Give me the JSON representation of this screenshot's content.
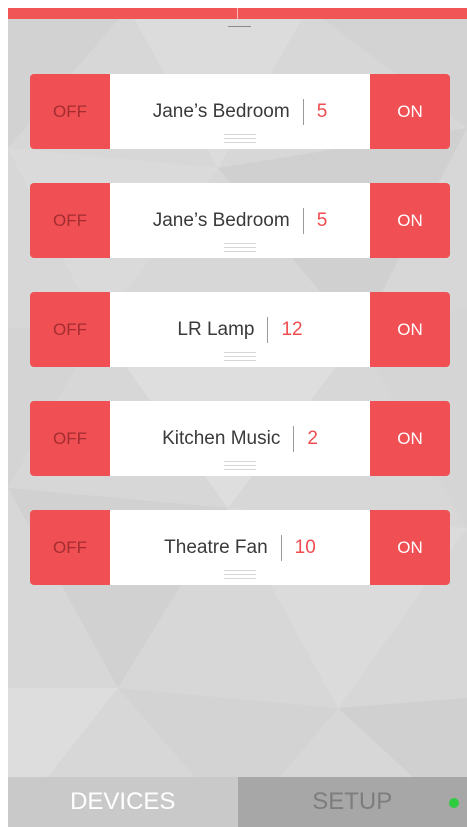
{
  "devices": [
    {
      "name": "Jane’s Bedroom",
      "count": "5",
      "off_label": "OFF",
      "on_label": "ON"
    },
    {
      "name": "Jane’s Bedroom",
      "count": "5",
      "off_label": "OFF",
      "on_label": "ON"
    },
    {
      "name": "LR Lamp",
      "count": "12",
      "off_label": "OFF",
      "on_label": "ON"
    },
    {
      "name": "Kitchen Music",
      "count": "2",
      "off_label": "OFF",
      "on_label": "ON"
    },
    {
      "name": "Theatre Fan",
      "count": "10",
      "off_label": "OFF",
      "on_label": "ON"
    }
  ],
  "tabs": {
    "devices_label": "DEVICES",
    "setup_label": "SETUP"
  },
  "colors": {
    "accent": "#f04f53",
    "background": "#d7d7d7",
    "status_online": "#2ecc40"
  },
  "icons": {
    "status": "online-status-dot-icon",
    "drag": "drag-handle-icon"
  }
}
